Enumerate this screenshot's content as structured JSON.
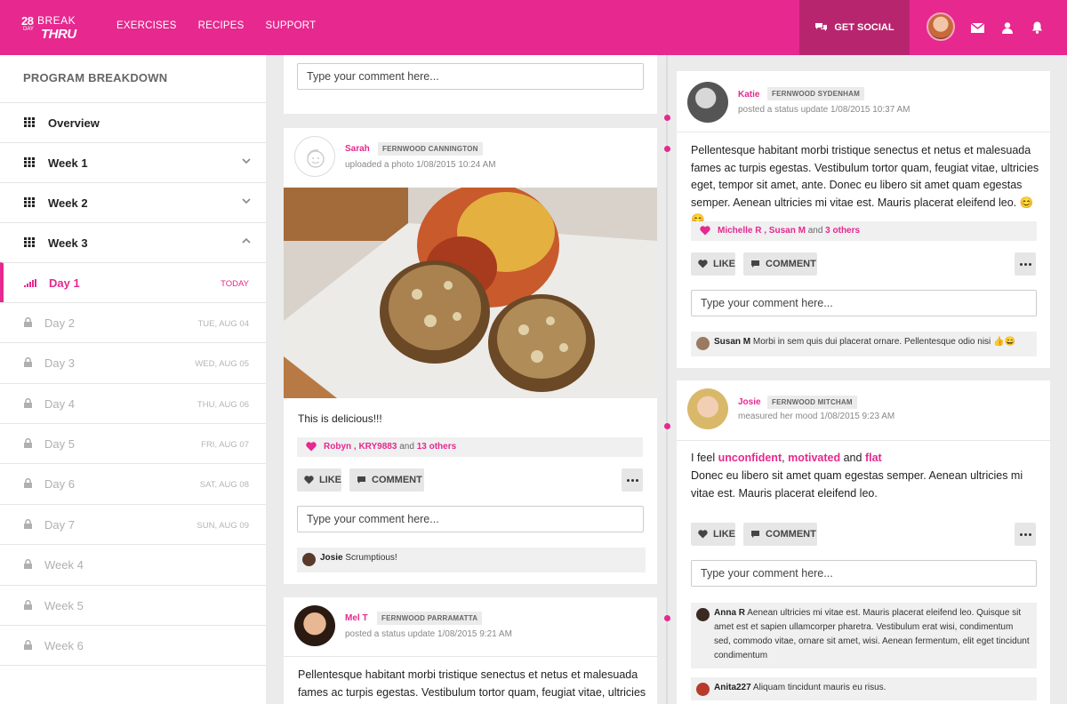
{
  "brand": {
    "number": "28",
    "days": "DAY",
    "break": "BREAK",
    "thru": "THRU"
  },
  "nav": [
    "EXERCISES",
    "RECIPES",
    "SUPPORT"
  ],
  "header": {
    "get_social": "GET SOCIAL"
  },
  "sidebar": {
    "title": "PROGRAM BREAKDOWN",
    "items": [
      {
        "label": "Overview"
      },
      {
        "label": "Week 1"
      },
      {
        "label": "Week 2"
      },
      {
        "label": "Week 3"
      }
    ],
    "days": [
      {
        "label": "Day 1",
        "date": "TODAY"
      },
      {
        "label": "Day 2",
        "date": "TUE, AUG 04"
      },
      {
        "label": "Day 3",
        "date": "WED, AUG 05"
      },
      {
        "label": "Day 4",
        "date": "THU, AUG 06"
      },
      {
        "label": "Day 5",
        "date": "FRI, AUG 07"
      },
      {
        "label": "Day 6",
        "date": "SAT, AUG 08"
      },
      {
        "label": "Day 7",
        "date": "SUN, AUG 09"
      }
    ],
    "weeks": [
      {
        "label": "Week 4"
      },
      {
        "label": "Week 5"
      },
      {
        "label": "Week 6"
      }
    ]
  },
  "common": {
    "comment_placeholder": "Type your comment here...",
    "like": "LIKE",
    "comment": "COMMENT",
    "and": "and"
  },
  "left_posts": {
    "sarah": {
      "name": "Sarah",
      "gym": "FERNWOOD CANNINGTON",
      "meta": "uploaded a photo 1/08/2015 10:24 AM",
      "caption": "This is delicious!!!",
      "likes_names": "Robyn , KRY9883",
      "likes_others": "13 others",
      "reply_name": "Josie",
      "reply_text": "Scrumptious!"
    },
    "melt": {
      "name": "Mel T",
      "gym": "FERNWOOD PARRAMATTA",
      "meta": "posted a status update 1/08/2015 9:21 AM",
      "body": "Pellentesque habitant morbi tristique senectus et netus et malesuada fames ac turpis egestas. Vestibulum tortor quam, feugiat vitae, ultricies"
    }
  },
  "right_posts": {
    "katie": {
      "name": "Katie",
      "gym": "FERNWOOD SYDENHAM",
      "meta": "posted a status update 1/08/2015 10:37 AM",
      "body": "Pellentesque habitant morbi tristique senectus et netus et malesuada fames ac turpis egestas. Vestibulum tortor quam, feugiat vitae, ultricies eget, tempor sit amet, ante. Donec eu libero sit amet quam egestas semper. Aenean ultricies mi vitae est. Mauris placerat eleifend leo.",
      "emoji": "😊😊",
      "likes_names": "Michelle R , Susan M",
      "likes_others": "3 others",
      "reply_name": "Susan M",
      "reply_text": "Morbi in sem quis dui placerat ornare. Pellentesque odio nisi",
      "reply_emoji": "👍😄"
    },
    "josie": {
      "name": "Josie",
      "gym": "FERNWOOD MITCHAM",
      "meta": "measured her mood 1/08/2015 9:23 AM",
      "feel_prefix": "I feel",
      "mood1": "unconfident",
      "mood2": "motivated",
      "mood3": "flat",
      "body": "Donec eu libero sit amet quam egestas semper. Aenean ultricies mi vitae est. Mauris placerat eleifend leo.",
      "reply1_name": "Anna R",
      "reply1_text": "Aenean ultricies mi vitae est. Mauris placerat eleifend leo. Quisque sit amet est et sapien ullamcorper pharetra. Vestibulum erat wisi, condimentum sed, commodo vitae, ornare sit amet, wisi. Aenean fermentum, elit eget tincidunt condimentum",
      "reply2_name": "Anita227",
      "reply2_text": "Aliquam tincidunt mauris eu risus."
    }
  },
  "colors": {
    "accent": "#e6288f",
    "get_social_bg": "#b8256f"
  }
}
